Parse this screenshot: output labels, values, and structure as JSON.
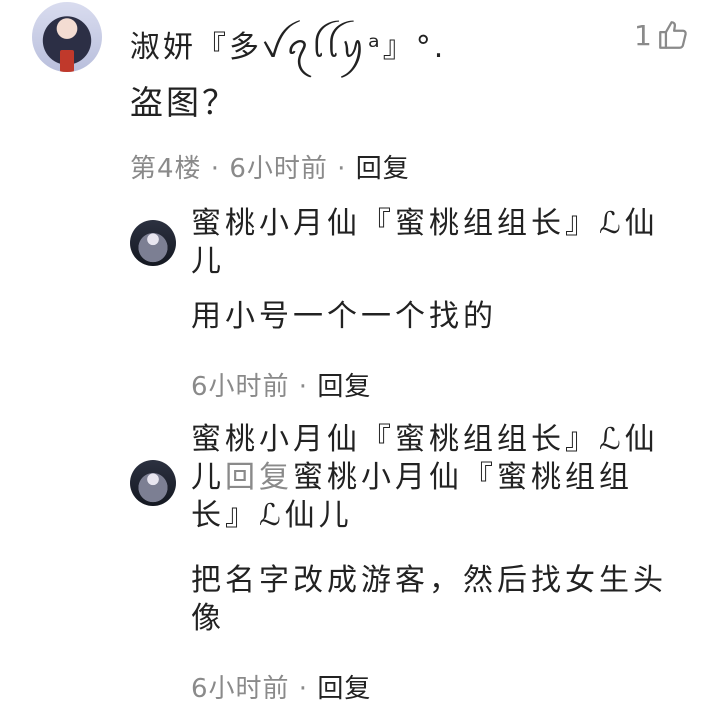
{
  "comment": {
    "username": "淑妍『多ꪜꪖꪶꪶꪗᵃ』°.",
    "likes": "1",
    "text": "盗图？",
    "floor": "第4楼",
    "time": "6小时前",
    "reply_label": "回复"
  },
  "replies": [
    {
      "author": "蜜桃小月仙『蜜桃组组长』ℒ仙儿",
      "text": "用小号一个一个找的",
      "time": "6小时前",
      "reply_label": "回复"
    },
    {
      "author": "蜜桃小月仙『蜜桃组组长』ℒ仙儿",
      "reply_word": "回复",
      "target": "蜜桃小月仙『蜜桃组组长』ℒ仙儿",
      "text": "把名字改成游客，然后找女生头像",
      "time": "6小时前",
      "reply_label": "回复"
    }
  ],
  "separator": " · ",
  "icons": {
    "like": "thumbs-up-icon"
  },
  "colors": {
    "text": "#222222",
    "muted": "#8a8a8a"
  }
}
